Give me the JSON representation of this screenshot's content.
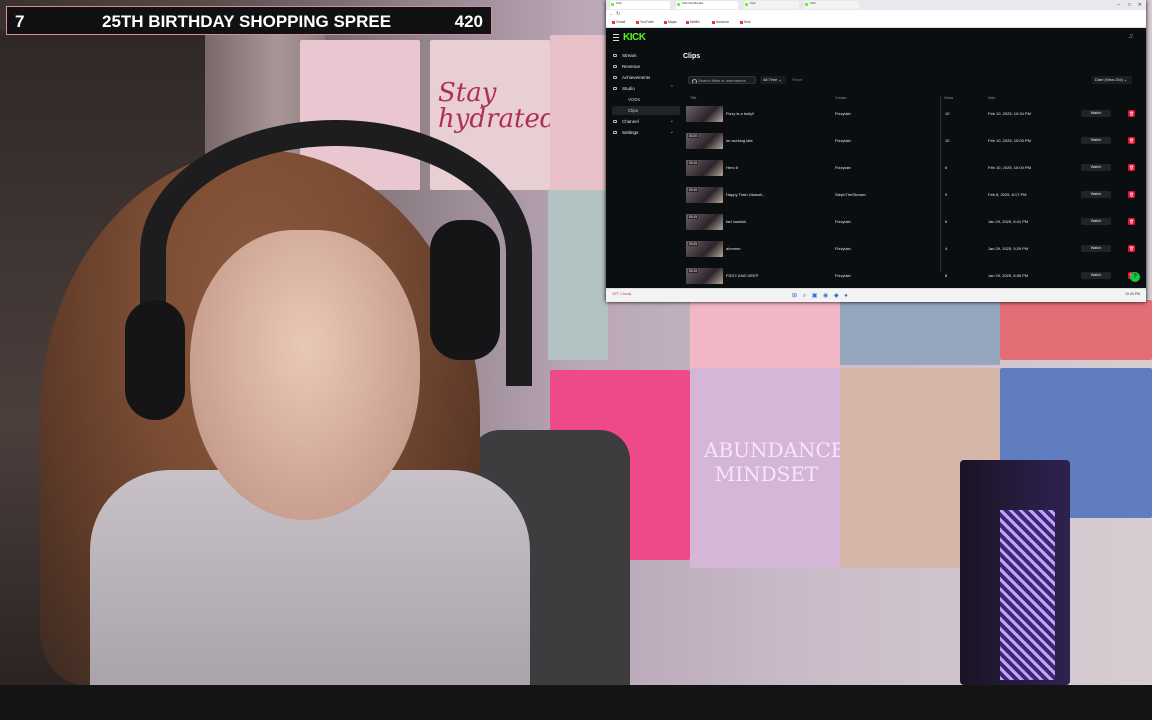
{
  "overlay": {
    "left_number": "7",
    "title": "25TH BIRTHDAY SHOPPING SPREE",
    "count": "420"
  },
  "scene": {
    "poster_texts": [
      "Stay hydrated",
      "ABUNDANCE MINDSET"
    ]
  },
  "browser": {
    "tabs": [
      "Kick",
      "Kick Dashboard",
      "Kick",
      "Kick"
    ],
    "url": "https://dashboard.kick.com/studio/clips",
    "bookmarks": [
      "Gmail",
      "YouTube",
      "Maps",
      "Netflix",
      "Amazon",
      "Kick"
    ]
  },
  "kick": {
    "logo": "KICK",
    "nav": [
      {
        "label": "Stream",
        "icon": "stream-icon"
      },
      {
        "label": "Revenue",
        "icon": "revenue-icon"
      },
      {
        "label": "Achievements",
        "icon": "achievements-icon"
      },
      {
        "label": "Studio",
        "icon": "studio-icon"
      },
      {
        "label": "VODs",
        "icon": ""
      },
      {
        "label": "Clips",
        "icon": ""
      },
      {
        "label": "Channel",
        "icon": "channel-icon"
      },
      {
        "label": "Settings",
        "icon": "settings-icon"
      }
    ],
    "page_title": "Clips",
    "search_placeholder": "Search titles or usernames",
    "time_filter": "All Time",
    "reset": "Reset",
    "sort": "Date (New-Old)",
    "columns": {
      "title": "Title",
      "creator": "Creator",
      "views": "Views",
      "date": "Date"
    },
    "clips": [
      {
        "duration": "",
        "title": "Fizzy is a bully!!",
        "creator": "Fizzytain",
        "views": "10",
        "date": "Feb 10, 2025, 10:34 PM"
      },
      {
        "duration": "00:20",
        "title": "im working late",
        "creator": "Fizzytain",
        "views": "10",
        "date": "Feb 10, 2025, 10:00 PM"
      },
      {
        "duration": "00:15",
        "title": "Hero 6",
        "creator": "Fizzytain",
        "views": "6",
        "date": "Feb 10, 2025, 10:00 PM"
      },
      {
        "duration": "00:10",
        "title": "Happy Train Ukanoli...",
        "creator": "StephTheShower",
        "views": "9",
        "date": "Feb 8, 2025, 8:17 PM"
      },
      {
        "duration": "00:15",
        "title": "fart insekkk",
        "creator": "Fizzytain",
        "views": "6",
        "date": "Jan 29, 2025, 8:41 PM"
      },
      {
        "duration": "00:25",
        "title": "ahmmm",
        "creator": "Fizzytain",
        "views": "4",
        "date": "Jan 29, 2025, 9:29 PM"
      },
      {
        "duration": "00:15",
        "title": "FIZZY AND DEEP",
        "creator": "Fizzytain",
        "views": "8",
        "date": "Jan 29, 2025, 8:05 PM"
      }
    ],
    "watch_label": "Watch",
    "help_icon": "help-icon"
  },
  "taskbar": {
    "weather": "25°F Cloudy",
    "clock": "10:40 PM"
  },
  "colors": {
    "kick_green": "#53fc18",
    "delete_red": "#e3132f",
    "overlay_border": "#d58aa7"
  }
}
